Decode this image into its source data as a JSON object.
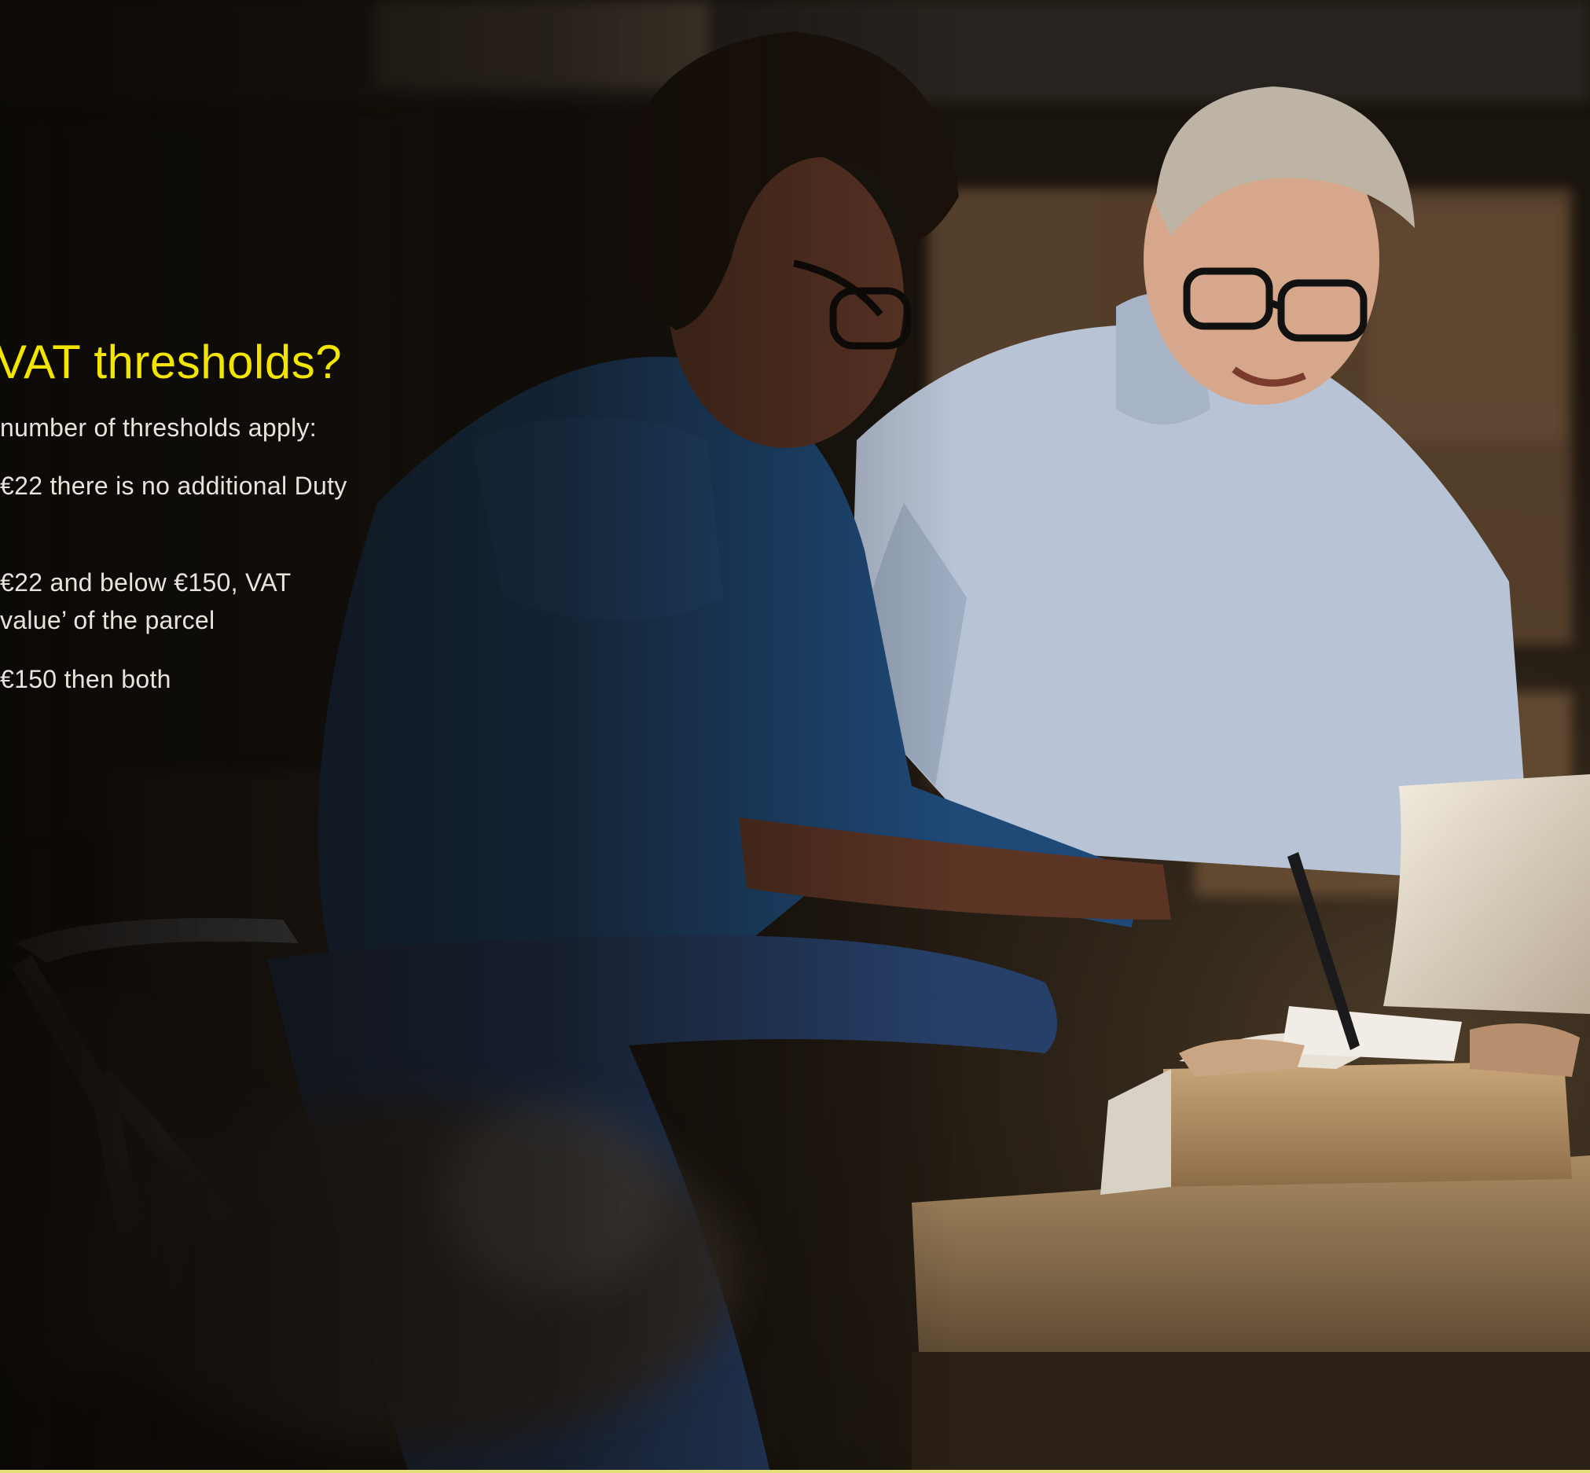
{
  "page": {
    "heading": "VAT thresholds?",
    "lines": [
      "number of thresholds apply:",
      "€22 there is no additional Duty",
      "€22 and below €150, VAT",
      "value’ of the parcel",
      "€150 then both"
    ]
  },
  "photo": {
    "description_icon": "warehouse-photo",
    "subjects": [
      "woman-in-denim-shirt",
      "man-in-light-blue-shirt",
      "laptop",
      "cardboard-box"
    ]
  },
  "colors": {
    "heading": "#f2e600",
    "body_text": "#e8e4dc",
    "background": "#120e0a",
    "bottom_rule": "#e6e07a"
  }
}
